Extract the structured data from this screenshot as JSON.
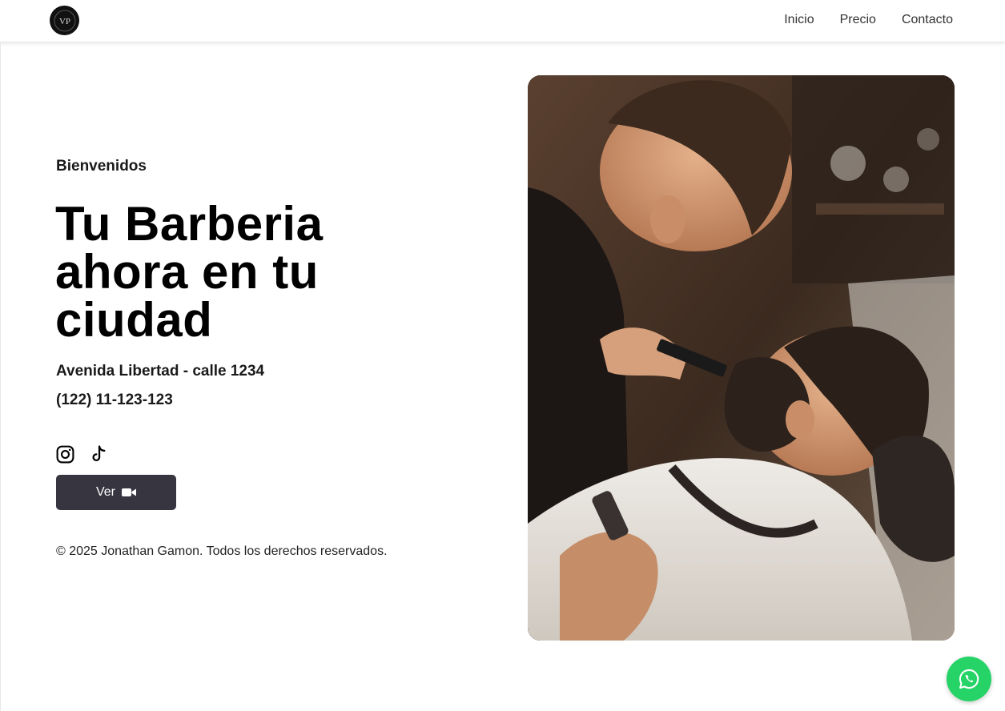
{
  "header": {
    "logo_text": "VP",
    "nav": [
      {
        "label": "Inicio"
      },
      {
        "label": "Precio"
      },
      {
        "label": "Contacto"
      }
    ]
  },
  "hero": {
    "welcome": "Bienvenidos",
    "headline_lines": [
      "Tu Barberia",
      "ahora en tu",
      "ciudad"
    ],
    "address": "Avenida Libertad - calle 1234",
    "phone": "(122) 11-123-123",
    "social_icons": [
      "instagram-icon",
      "tiktok-icon"
    ],
    "button_label": "Ver",
    "button_icon": "video-camera-icon",
    "copyright": "© 2025 Jonathan Gamon. Todos los derechos reservados.",
    "image_alt": "Barbero recortando la barba de un cliente"
  },
  "whatsapp": {
    "icon": "whatsapp-icon",
    "color": "#25d366"
  },
  "colors": {
    "button_bg": "#363540",
    "text": "#000000",
    "nav_text": "#333333"
  }
}
